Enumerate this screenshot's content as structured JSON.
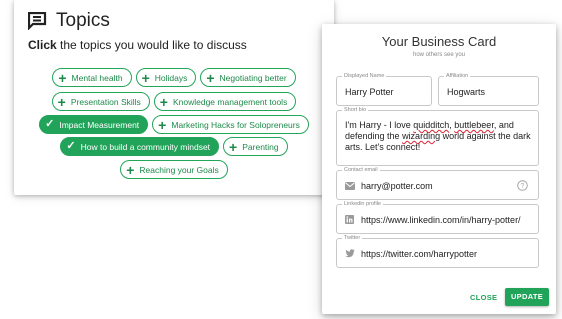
{
  "topics": {
    "title": "Topics",
    "subtitle_bold": "Click",
    "subtitle_rest": " the topics you would like to discuss",
    "rows": [
      [
        {
          "label": "Mental health",
          "selected": false
        },
        {
          "label": "Holidays",
          "selected": false
        },
        {
          "label": "Negotiating better",
          "selected": false
        }
      ],
      [
        {
          "label": "Presentation Skills",
          "selected": false
        },
        {
          "label": "Knowledge management tools",
          "selected": false
        }
      ],
      [
        {
          "label": "Impact Measurement",
          "selected": true
        },
        {
          "label": "Marketing Hacks for Solopreneurs",
          "selected": false
        }
      ],
      [
        {
          "label": "How to build a community mindset",
          "selected": true
        },
        {
          "label": "Parenting",
          "selected": false
        }
      ],
      [
        {
          "label": "Reaching your Goals",
          "selected": false
        }
      ]
    ]
  },
  "card": {
    "title": "Your Business Card",
    "subtitle": "how others see you",
    "displayed_name_label": "Displayed Name",
    "displayed_name": "Harry Potter",
    "affiliation_label": "Affiliation",
    "affiliation": "Hogwarts",
    "short_bio_label": "Short bio",
    "bio_p1": "I'm Harry - I love ",
    "bio_w1": "quidditch",
    "bio_p2": ", ",
    "bio_w2": "buttlebeer",
    "bio_p3": ", and defending the ",
    "bio_w3": "wizarding",
    "bio_p4": " world against the dark arts. Let's connect!",
    "email_label": "Contact email",
    "email": "harry@potter.com",
    "linkedin_label": "Linkedin profile",
    "linkedin": "https://www.linkedin.com/in/harry-potter/",
    "twitter_label": "Twitter",
    "twitter": "https://twitter.com/harrypotter",
    "close_label": "CLOSE",
    "update_label": "UPDATE"
  },
  "colors": {
    "accent": "#22a35a",
    "accent_text": "#1d8a4b"
  }
}
